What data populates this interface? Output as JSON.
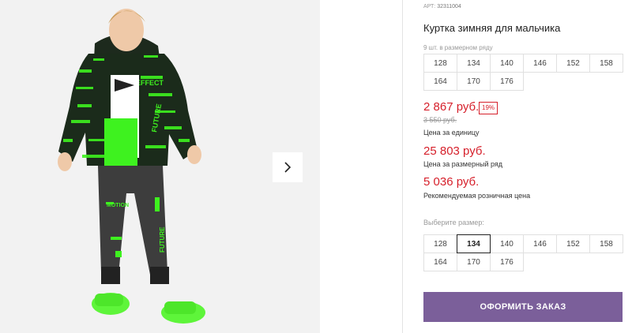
{
  "gallery": {
    "next_icon": "chevron-right-icon",
    "image_text": {
      "effect": "EFFECT",
      "future": "FUTURE",
      "motion": "MOTION"
    }
  },
  "product": {
    "art_label": "АРТ:",
    "art_number": "32311004",
    "title": "Куртка зимняя для мальчика",
    "row_note": "9 шт. в размерном ряду",
    "row_sizes": [
      "128",
      "134",
      "140",
      "146",
      "152",
      "158",
      "164",
      "170",
      "176"
    ],
    "price": "2 867 руб.",
    "discount": "19%",
    "old_price": "3 550 руб.",
    "unit_price_caption": "Цена за единицу",
    "row_price": "25 803 руб.",
    "row_price_caption": "Цена за размерный ряд",
    "retail_price": "5 036 руб.",
    "retail_price_caption": "Рекомендуемая розничная цена",
    "choose_size_label": "Выберите размер:",
    "select_sizes": [
      "128",
      "134",
      "140",
      "146",
      "152",
      "158",
      "164",
      "170",
      "176"
    ],
    "selected_size": "134",
    "order_button": "ОФОРМИТЬ ЗАКАЗ"
  },
  "colors": {
    "accent_red": "#d6202b",
    "button_purple": "#7b5f9a",
    "jacket_green": "#3ef21f"
  }
}
